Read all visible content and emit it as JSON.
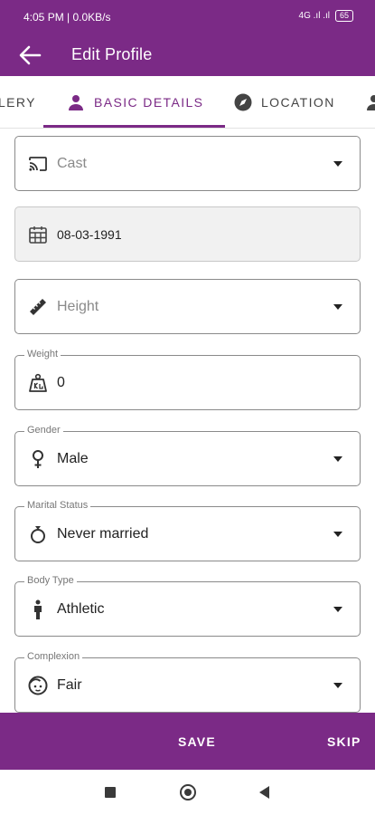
{
  "status_bar": {
    "time": "4:05 PM | 0.0KB/s",
    "signal": "4G .ıl .ıl",
    "battery": "65"
  },
  "app_bar": {
    "title": "Edit Profile"
  },
  "tabs": [
    {
      "label": "LERY"
    },
    {
      "label": "BASIC DETAILS",
      "active": true
    },
    {
      "label": "LOCATION"
    }
  ],
  "fields": {
    "cast": {
      "placeholder": "Cast"
    },
    "dob": {
      "value": "08-03-1991"
    },
    "height": {
      "placeholder": "Height"
    },
    "weight": {
      "label": "Weight",
      "value": "0"
    },
    "gender": {
      "label": "Gender",
      "value": "Male"
    },
    "marital_status": {
      "label": "Marital Status",
      "value": "Never married"
    },
    "body_type": {
      "label": "Body Type",
      "value": "Athletic"
    },
    "complexion": {
      "label": "Complexion",
      "value": "Fair"
    }
  },
  "bottom_bar": {
    "save_label": "SAVE",
    "skip_label": "SKIP"
  },
  "colors": {
    "primary": "#7b2a86",
    "border": "#8a8a8a"
  }
}
